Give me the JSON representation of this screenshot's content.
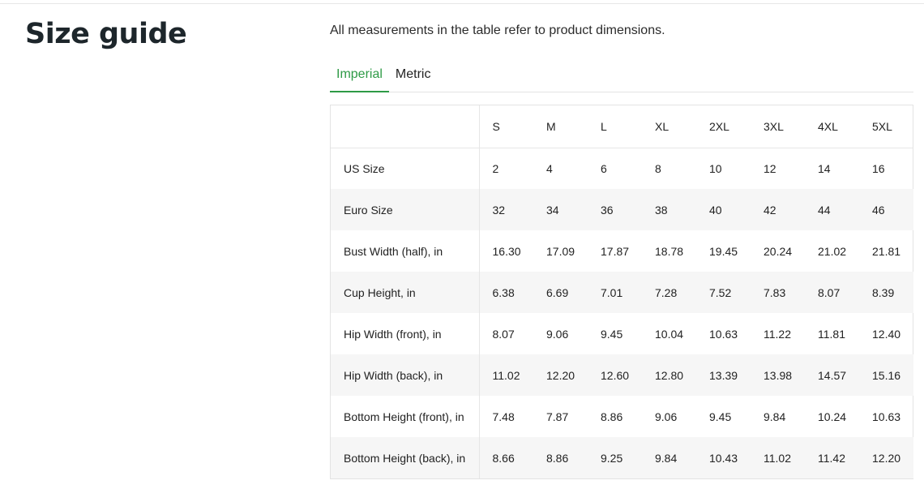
{
  "page": {
    "title": "Size guide",
    "intro": "All measurements in the table refer to product dimensions."
  },
  "tabs": [
    {
      "label": "Imperial",
      "active": true
    },
    {
      "label": "Metric",
      "active": false
    }
  ],
  "colors": {
    "accent": "#2e9a46",
    "title": "#1d262b",
    "row_stripe": "#f6f6f6",
    "border": "#e3e3e3"
  },
  "table": {
    "sizes": [
      "S",
      "M",
      "L",
      "XL",
      "2XL",
      "3XL",
      "4XL",
      "5XL"
    ],
    "rows": [
      {
        "label": "US Size",
        "values": [
          "2",
          "4",
          "6",
          "8",
          "10",
          "12",
          "14",
          "16"
        ]
      },
      {
        "label": "Euro Size",
        "values": [
          "32",
          "34",
          "36",
          "38",
          "40",
          "42",
          "44",
          "46"
        ]
      },
      {
        "label": "Bust Width (half), in",
        "values": [
          "16.30",
          "17.09",
          "17.87",
          "18.78",
          "19.45",
          "20.24",
          "21.02",
          "21.81"
        ]
      },
      {
        "label": "Cup Height, in",
        "values": [
          "6.38",
          "6.69",
          "7.01",
          "7.28",
          "7.52",
          "7.83",
          "8.07",
          "8.39"
        ]
      },
      {
        "label": "Hip Width (front), in",
        "values": [
          "8.07",
          "9.06",
          "9.45",
          "10.04",
          "10.63",
          "11.22",
          "11.81",
          "12.40"
        ]
      },
      {
        "label": "Hip Width (back), in",
        "values": [
          "11.02",
          "12.20",
          "12.60",
          "12.80",
          "13.39",
          "13.98",
          "14.57",
          "15.16"
        ]
      },
      {
        "label": "Bottom Height (front), in",
        "values": [
          "7.48",
          "7.87",
          "8.86",
          "9.06",
          "9.45",
          "9.84",
          "10.24",
          "10.63"
        ]
      },
      {
        "label": "Bottom Height (back), in",
        "values": [
          "8.66",
          "8.86",
          "9.25",
          "9.84",
          "10.43",
          "11.02",
          "11.42",
          "12.20"
        ]
      }
    ]
  }
}
